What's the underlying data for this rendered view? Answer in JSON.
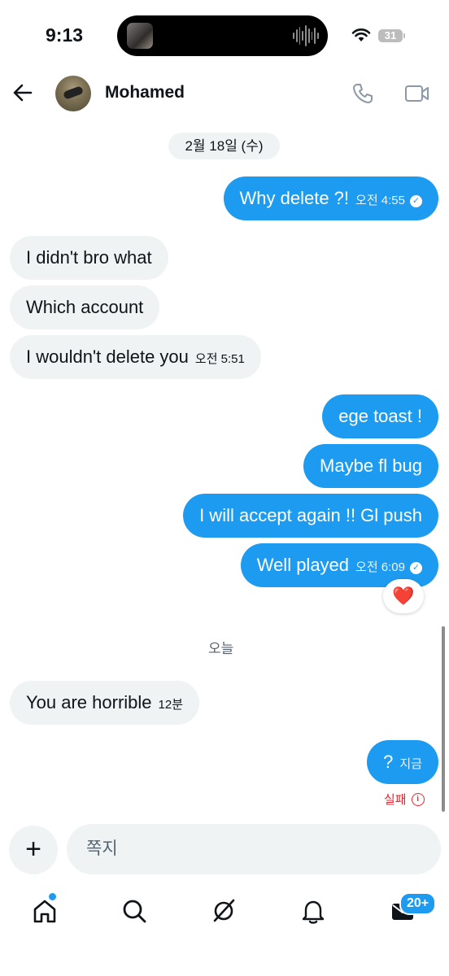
{
  "status_bar": {
    "time": "9:13",
    "battery": "31"
  },
  "header": {
    "contact_name": "Mohamed"
  },
  "conversation": {
    "date_chip": "2월 18일 (수)",
    "today_divider": "오늘",
    "messages": [
      {
        "dir": "out",
        "text": "Why delete ?!",
        "time": "오전 4:55"
      },
      {
        "dir": "in",
        "text": "I didn't bro what"
      },
      {
        "dir": "in",
        "text": "Which account"
      },
      {
        "dir": "in",
        "text": "I wouldn't delete you",
        "time": "오전 5:51"
      },
      {
        "dir": "out",
        "text": "ege toast !"
      },
      {
        "dir": "out",
        "text": "Maybe fl bug"
      },
      {
        "dir": "out",
        "text": "I will accept again !! Gl push"
      },
      {
        "dir": "out",
        "text": "Well played",
        "time": "오전 6:09"
      },
      {
        "dir": "in",
        "text": "You are horrible",
        "time": "12분"
      },
      {
        "dir": "out",
        "text": "?",
        "time": "지금"
      }
    ],
    "reaction": "❤️",
    "failed_label": "실패"
  },
  "composer": {
    "placeholder": "쪽지"
  },
  "tab_bar": {
    "messages_badge": "20+"
  },
  "colors": {
    "accent": "#1d9bf0",
    "bubble_in": "#eff3f4",
    "error": "#f4212e"
  }
}
